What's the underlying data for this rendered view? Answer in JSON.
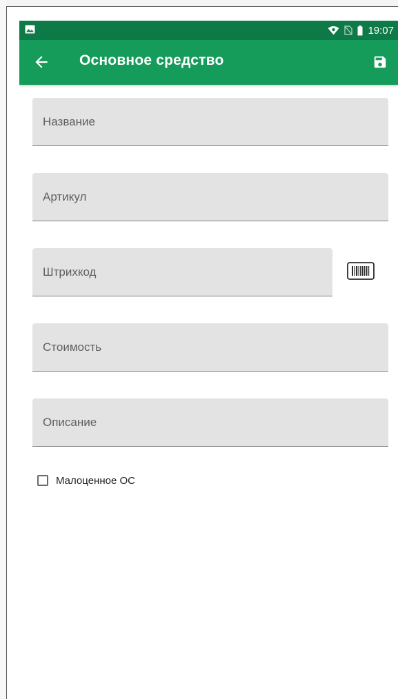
{
  "status_bar": {
    "time": "19:07",
    "icons": [
      "image-icon",
      "wifi-icon",
      "no-sim-icon",
      "battery-icon"
    ]
  },
  "app_bar": {
    "title": "Основное средство",
    "back_icon": "arrow-back-icon",
    "save_icon": "save-icon",
    "color": "#159b5a",
    "status_color": "#0d7a47"
  },
  "form": {
    "name_placeholder": "Название",
    "article_placeholder": "Артикул",
    "barcode_placeholder": "Штрихкод",
    "cost_placeholder": "Стоимость",
    "description_placeholder": "Описание",
    "name_value": "",
    "article_value": "",
    "barcode_value": "",
    "cost_value": "",
    "description_value": "",
    "barcode_scan_icon": "barcode-icon",
    "low_value_label": "Малоценное ОС",
    "low_value_checked": false
  }
}
